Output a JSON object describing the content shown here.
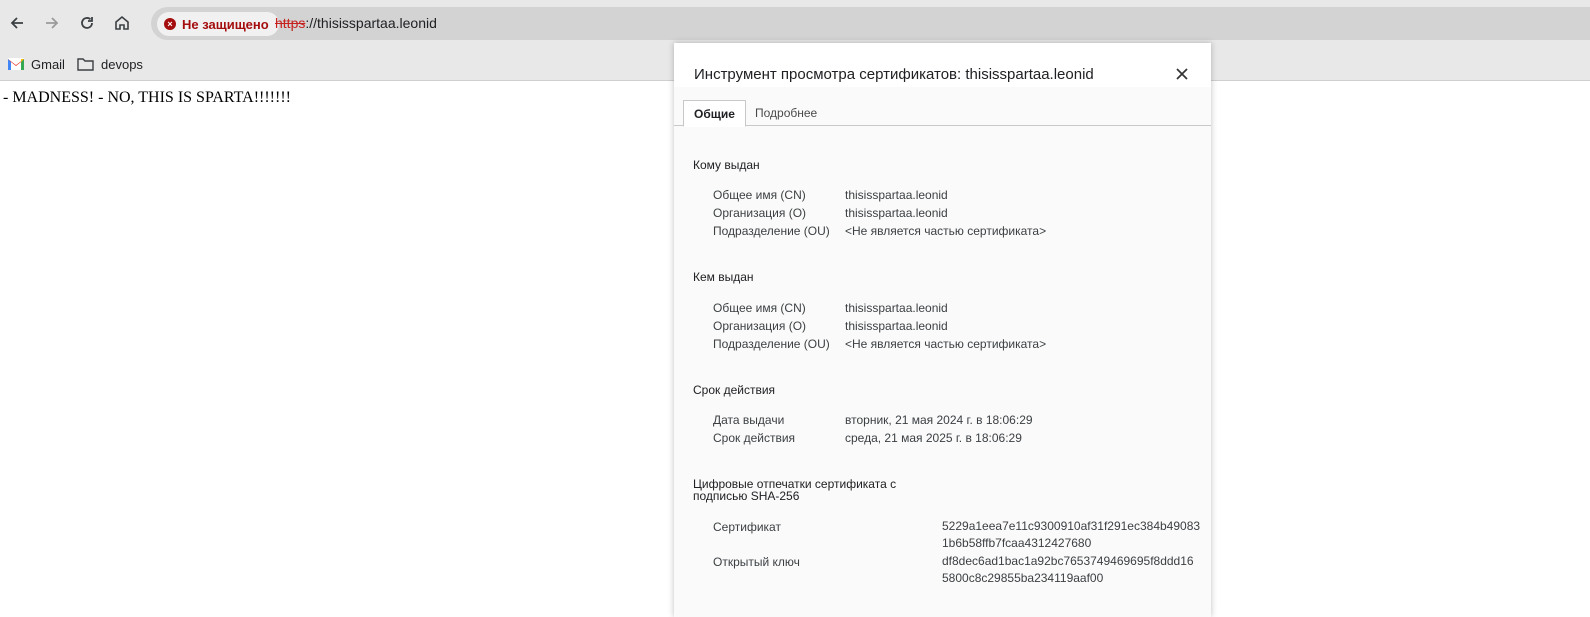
{
  "browser": {
    "security_label": "Не защищено",
    "url_scheme": "https",
    "url_rest": "://thisisspartaa.leonid",
    "security_color": "#a50e0e"
  },
  "bookmarks": [
    {
      "label": "Gmail",
      "icon": "gmail-icon"
    },
    {
      "label": "devops",
      "icon": "folder-icon"
    }
  ],
  "page": {
    "text": "- MADNESS! - NO, THIS IS SPARTA!!!!!!!"
  },
  "dialog": {
    "title": "Инструмент просмотра сертификатов: thisisspartaa.leonid",
    "tabs": [
      "Общие",
      "Подробнее"
    ],
    "issued_to": {
      "title": "Кому выдан",
      "rows": [
        {
          "label": "Общее имя (CN)",
          "value": "thisisspartaa.leonid"
        },
        {
          "label": "Организация (O)",
          "value": "thisisspartaa.leonid"
        },
        {
          "label": "Подразделение (OU)",
          "value": "<Не является частью сертификата>"
        }
      ]
    },
    "issued_by": {
      "title": "Кем выдан",
      "rows": [
        {
          "label": "Общее имя (CN)",
          "value": "thisisspartaa.leonid"
        },
        {
          "label": "Организация (O)",
          "value": "thisisspartaa.leonid"
        },
        {
          "label": "Подразделение (OU)",
          "value": "<Не является частью сертификата>"
        }
      ]
    },
    "validity": {
      "title": "Срок действия",
      "rows": [
        {
          "label": "Дата выдачи",
          "value": "вторник, 21 мая 2024 г. в 18:06:29"
        },
        {
          "label": "Срок действия",
          "value": "среда, 21 мая 2025 г. в 18:06:29"
        }
      ]
    },
    "fingerprints": {
      "title_line1": "Цифровые отпечатки сертификата с",
      "title_line2": "подписью SHA-256",
      "rows": [
        {
          "label": "Сертификат",
          "line1": "5229a1eea7e11c9300910af31f291ec384b49083",
          "line2": "1b6b58ffb7fcaa4312427680"
        },
        {
          "label": "Открытый ключ",
          "line1": "df8dec6ad1bac1a92bc7653749469695f8ddd16",
          "line2": "5800c8c29855ba234119aaf00"
        }
      ]
    }
  }
}
